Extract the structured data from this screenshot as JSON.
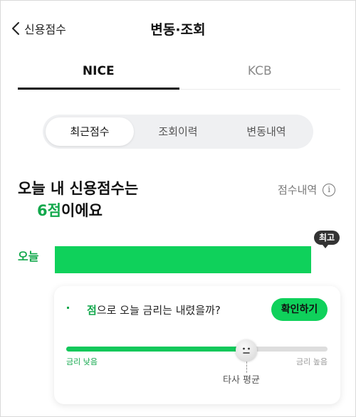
{
  "header": {
    "back_label": "신용점수",
    "title": "변동·조회"
  },
  "provider_tabs": [
    {
      "label": "NICE",
      "active": true
    },
    {
      "label": "KCB",
      "active": false
    }
  ],
  "segments": [
    {
      "label": "최근점수",
      "active": true
    },
    {
      "label": "조회이력",
      "active": false
    },
    {
      "label": "변동내역",
      "active": false
    }
  ],
  "summary": {
    "line1": "오늘 내 신용점수는",
    "score_text": "6점",
    "suffix": "이에요",
    "history_link": "점수내역",
    "info_icon": "i"
  },
  "today": {
    "label": "오늘",
    "badge": "최고",
    "bar_fill": 1.0
  },
  "rate_card": {
    "question_highlight": "점",
    "question_rest": "으로 오늘 금리는 내렸을까?",
    "confirm_button": "확인하기",
    "slider_level": 0.69,
    "low_label": "금리 낮음",
    "high_label": "금리 높음",
    "avg_label": "타사 평균"
  },
  "colors": {
    "accent": "#12a84c",
    "bar": "#0fd15b",
    "badge": "#333333"
  }
}
